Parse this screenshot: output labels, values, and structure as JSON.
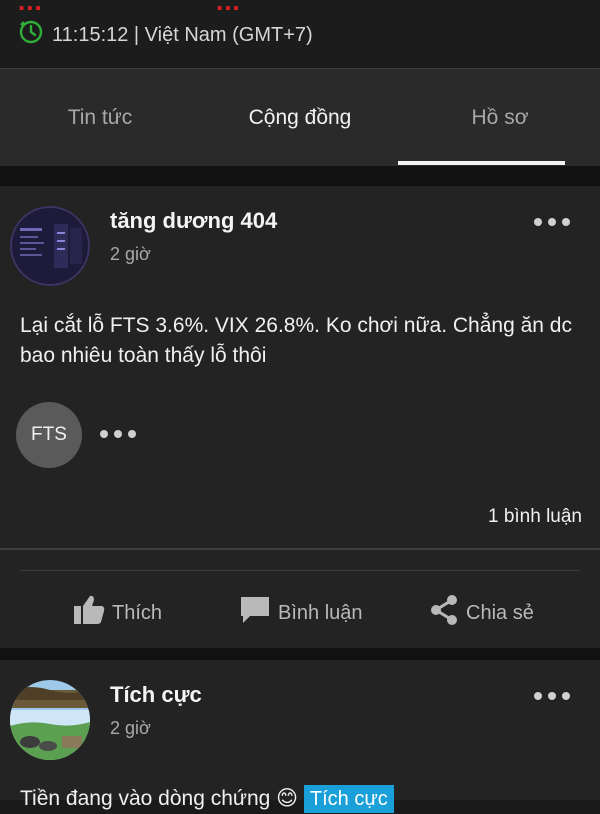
{
  "header": {
    "top_left": "...",
    "top_right": "...",
    "clock_text": "11:15:12 | Việt Nam (GMT+7)"
  },
  "tabs": [
    {
      "label": "Tin tức"
    },
    {
      "label": "Cộng đồng"
    },
    {
      "label": "Hồ sơ"
    }
  ],
  "posts": [
    {
      "author": "tăng dương 404",
      "time": "2 giờ",
      "text": "Lại cắt lỗ FTS 3.6%. VIX 26.8%. Ko chơi nữa. Chẳng ăn dc bao nhiêu toàn thấy lỗ thôi",
      "ticker": "FTS",
      "comments": "1 bình luận"
    },
    {
      "author": "Tích cực",
      "time": "2 giờ",
      "text": "Tiền đang vào dòng chứng 😊",
      "tag": "Tích cực"
    }
  ],
  "actions": {
    "like": "Thích",
    "comment": "Bình luận",
    "share": "Chia sẻ"
  },
  "colors": {
    "accent_red": "#e02020",
    "tag_blue": "#1aa0d8",
    "clock_green": "#2fae3a"
  }
}
